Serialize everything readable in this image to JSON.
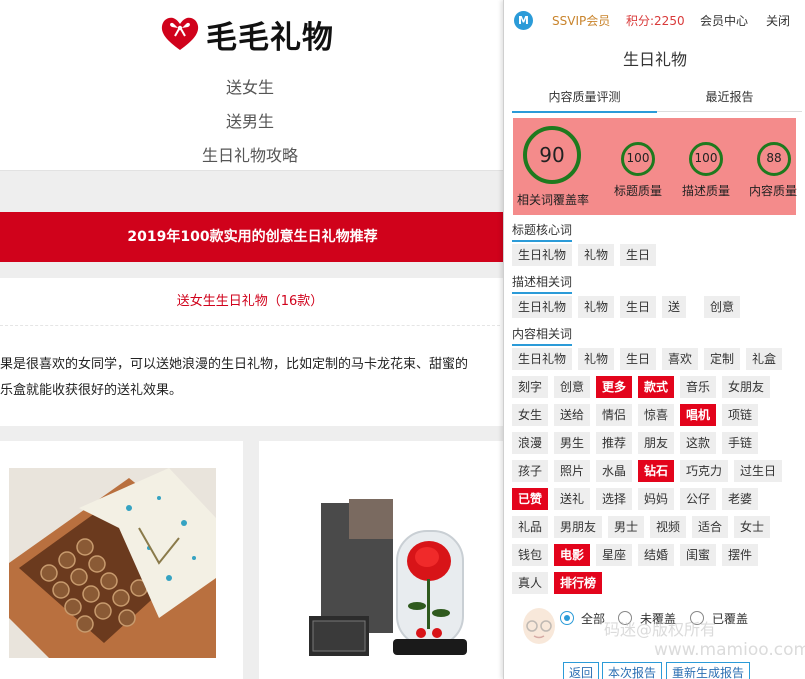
{
  "page": {
    "logo_text": "毛毛礼物",
    "nav": [
      "送女生",
      "送男生",
      "生日礼物攻略"
    ],
    "banner": "2019年100款实用的创意生日礼物推荐",
    "subtitle": "送女生生日礼物（16款）",
    "paragraph_line1": "果是很喜欢的女同学，可以送她浪漫的生日礼物，比如定制的马卡龙花束、甜蜜的",
    "paragraph_line2": "乐盒就能收获很好的送礼效果。"
  },
  "panel": {
    "logo_letter": "M",
    "vip": "SSVIP会员",
    "points": "积分:2250",
    "member_center": "会员中心",
    "close": "关闭",
    "title": "生日礼物",
    "tabs": [
      "内容质量评测",
      "最近报告"
    ],
    "scores": [
      {
        "value": "90",
        "label": "相关词覆盖率"
      },
      {
        "value": "100",
        "label": "标题质量"
      },
      {
        "value": "100",
        "label": "描述质量"
      },
      {
        "value": "88",
        "label": "内容质量"
      }
    ],
    "sections": {
      "title_core": "标题核心词",
      "desc_related": "描述相关词",
      "content_related": "内容相关词"
    },
    "title_tags": [
      "生日礼物",
      "礼物",
      "生日"
    ],
    "desc_tags": [
      "生日礼物",
      "礼物",
      "生日",
      "送",
      "创意"
    ],
    "content_tags": [
      [
        "生日礼物",
        "礼物",
        "生日",
        "喜欢",
        "定制",
        "礼盒"
      ],
      [
        "刻字",
        "创意",
        "更多",
        "款式",
        "音乐",
        "女朋友"
      ],
      [
        "女生",
        "送给",
        "情侣",
        "惊喜",
        "唱机",
        "项链"
      ],
      [
        "浪漫",
        "男生",
        "推荐",
        "朋友",
        "这款",
        "手链"
      ],
      [
        "孩子",
        "照片",
        "水晶",
        "钻石",
        "巧克力",
        "过生日"
      ],
      [
        "已赞",
        "送礼",
        "选择",
        "妈妈",
        "公仔",
        "老婆"
      ],
      [
        "礼品",
        "男朋友",
        "男士",
        "视频",
        "适合",
        "女士"
      ],
      [
        "钱包",
        "电影",
        "星座",
        "结婚",
        "闺蜜",
        "摆件"
      ],
      [
        "真人",
        "排行榜"
      ]
    ],
    "highlighted_tags": [
      "更多",
      "款式",
      "唱机",
      "钻石",
      "已赞",
      "电影",
      "排行榜"
    ],
    "filters": [
      "全部",
      "未覆盖",
      "已覆盖"
    ],
    "filter_selected": "全部",
    "buttons": [
      "返回",
      "本次报告",
      "重新生成报告"
    ],
    "watermark1": "码迷@版权所有",
    "watermark2": "www.mamioo.com"
  },
  "colors": {
    "brand_red": "#d0021b",
    "score_bg": "#f48b8b",
    "accent_blue": "#2b9bd8",
    "ring_green": "#1e7a1e"
  }
}
